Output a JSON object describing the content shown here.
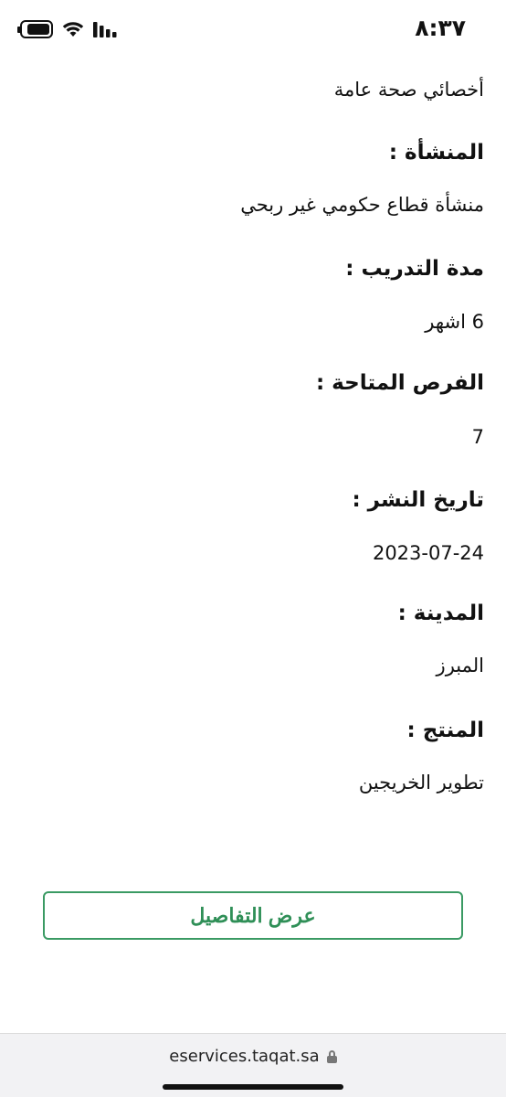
{
  "status_bar": {
    "time": "٨:٣٧",
    "battery_level": 0.85
  },
  "fields": [
    {
      "id": "specialty",
      "value": "أخصائي صحة عامة"
    },
    {
      "id": "facility",
      "label": "المنشأة :",
      "value": "منشأة قطاع حكومي غير ربحي"
    },
    {
      "id": "training-duration",
      "label": "مدة التدريب :",
      "value": "6 اشهر"
    },
    {
      "id": "available-opportunities",
      "label": "الفرص المتاحة :",
      "value": "7"
    },
    {
      "id": "publish-date",
      "label": "تاريخ النشر :",
      "value": "2023-07-24"
    },
    {
      "id": "city",
      "label": "المدينة :",
      "value": "المبرز"
    },
    {
      "id": "product",
      "label": "المنتج :",
      "value": "تطوير الخريجين"
    }
  ],
  "actions": {
    "details_label": "عرض التفاصيل"
  },
  "browser": {
    "url": "eservices.taqat.sa"
  },
  "colors": {
    "accent": "#2f8f57",
    "button_border": "#3a9a63",
    "browser_bar_bg": "#f2f2f4"
  },
  "icons": [
    "battery-icon",
    "wifi-icon",
    "signal-icon",
    "lock-icon"
  ]
}
